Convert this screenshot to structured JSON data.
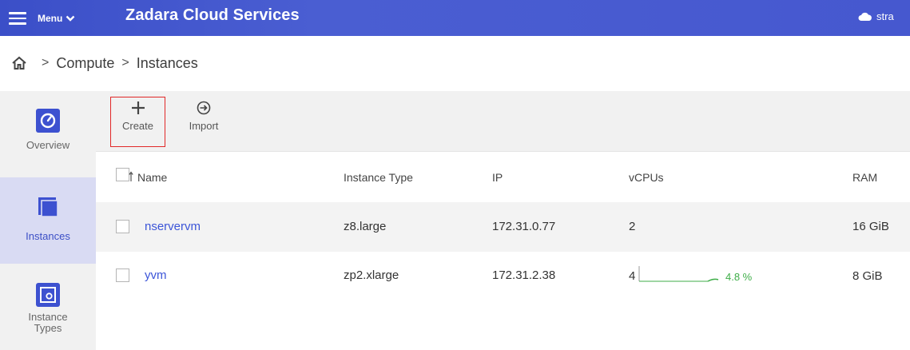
{
  "topbar": {
    "menu_label": "Menu",
    "app_title": "Zadara Cloud Services",
    "user_label": "stra"
  },
  "breadcrumb": {
    "items": [
      "Compute",
      "Instances"
    ],
    "separator": ">"
  },
  "sidebar": {
    "items": [
      {
        "label": "Overview",
        "icon": "gauge-icon",
        "active": false
      },
      {
        "label": "Instances",
        "icon": "instances-icon",
        "active": true
      },
      {
        "label": "Instance Types",
        "icon": "instance-types-icon",
        "active": false
      }
    ]
  },
  "toolbar": {
    "create_label": "Create",
    "import_label": "Import"
  },
  "table": {
    "columns": [
      "Name",
      "Instance Type",
      "IP",
      "vCPUs",
      "RAM"
    ],
    "rows": [
      {
        "name": "nservervm",
        "instance_type": "z8.large",
        "ip": "172.31.0.77",
        "vcpus": "2",
        "cpu_usage": "",
        "ram": "16 GiB"
      },
      {
        "name": "yvm",
        "instance_type": "zp2.xlarge",
        "ip": "172.31.2.38",
        "vcpus": "4",
        "cpu_usage": "4.8 %",
        "ram": "8 GiB"
      }
    ]
  },
  "colors": {
    "accent": "#3d51d0",
    "link": "#3c55d8",
    "usage_green": "#3fae49",
    "highlight_border": "#e12828"
  }
}
